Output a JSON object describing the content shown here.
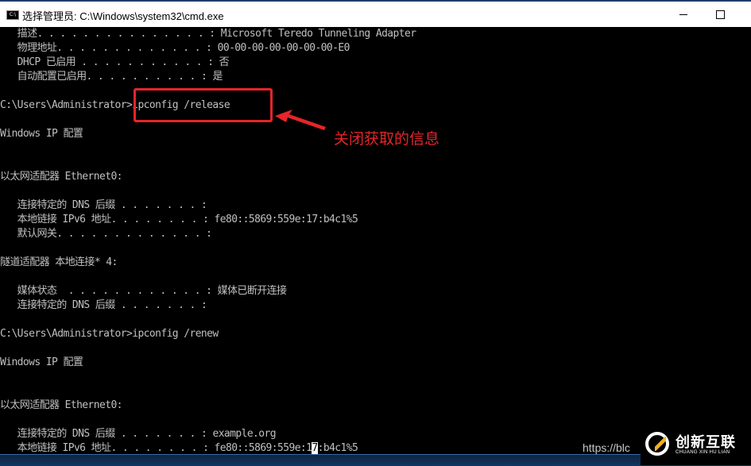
{
  "window": {
    "title": "选择管理员: C:\\Windows\\system32\\cmd.exe",
    "app_icon": "cmd-icon",
    "controls": [
      "minimize",
      "maximize"
    ]
  },
  "console": {
    "lines": [
      "   描述. . . . . . . . . . . . . . . : Microsoft Teredo Tunneling Adapter",
      "   物理地址. . . . . . . . . . . . . : 00-00-00-00-00-00-00-E0",
      "   DHCP 已启用 . . . . . . . . . . . : 否",
      "   自动配置已启用. . . . . . . . . . : 是",
      "",
      "C:\\Users\\Administrator>ipconfig /release",
      "",
      "Windows IP 配置",
      "",
      "",
      "以太网适配器 Ethernet0:",
      "",
      "   连接特定的 DNS 后缀 . . . . . . . :",
      "   本地链接 IPv6 地址. . . . . . . . : fe80::5869:559e:17:b4c1%5",
      "   默认网关. . . . . . . . . . . . . :",
      "",
      "隧道适配器 本地连接* 4:",
      "",
      "   媒体状态  . . . . . . . . . . . . : 媒体已断开连接",
      "   连接特定的 DNS 后缀 . . . . . . . :",
      "",
      "C:\\Users\\Administrator>ipconfig /renew",
      "",
      "Windows IP 配置",
      "",
      "",
      "以太网适配器 Ethernet0:",
      "",
      "   连接特定的 DNS 后缀 . . . . . . . : example.org"
    ],
    "last_line_before_cursor": "   本地链接 IPv6 地址. . . . . . . . : fe80::5869:559e:1",
    "cursor_char": "7",
    "last_line_after_cursor": ":b4c1%5"
  },
  "annotation": {
    "text": "关闭获取的信息",
    "color": "#e5252a",
    "target": "ipconfig /release"
  },
  "watermark": {
    "url_fragment": "https://blc",
    "brand_name": "创新互联",
    "brand_sub": "CHUANG XIN HU LIAN"
  }
}
